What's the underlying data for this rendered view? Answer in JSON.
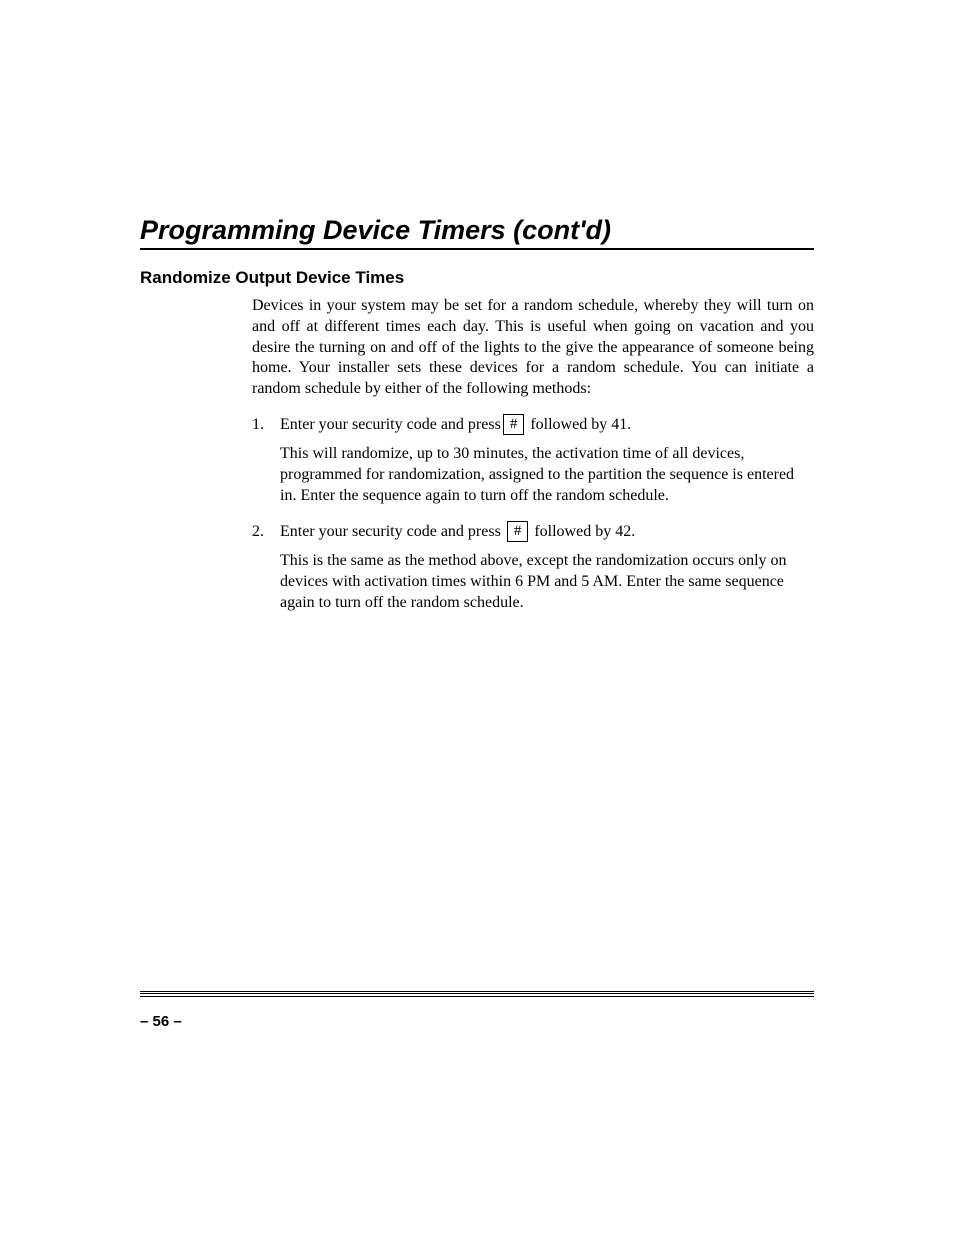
{
  "title": "Programming Device Timers (cont'd)",
  "subheading": "Randomize Output Device Times",
  "intro": "Devices in your system may be set for a random schedule, whereby they will turn on and off at different times each day. This is useful when going on vacation and you desire the turning on and off of the lights to the give the appearance of someone being home. Your installer sets these devices for a random schedule. You can initiate a random schedule by either of the following methods:",
  "items": [
    {
      "num": "1.",
      "lead": "Enter your security code and press",
      "key": "#",
      "tail": " followed by 41.",
      "body": "This will randomize, up to 30 minutes, the activation time of all devices, programmed for randomization, assigned to the partition the sequence is entered in. Enter the sequence again to turn off the random schedule."
    },
    {
      "num": "2.",
      "lead": "Enter your security code and press ",
      "key": "#",
      "tail": " followed by 42.",
      "body": "This is the same as the method above, except the randomization occurs only on devices with activation times within 6 PM and 5 AM. Enter the same sequence again to turn off the random schedule."
    }
  ],
  "page_num": "– 56 –"
}
